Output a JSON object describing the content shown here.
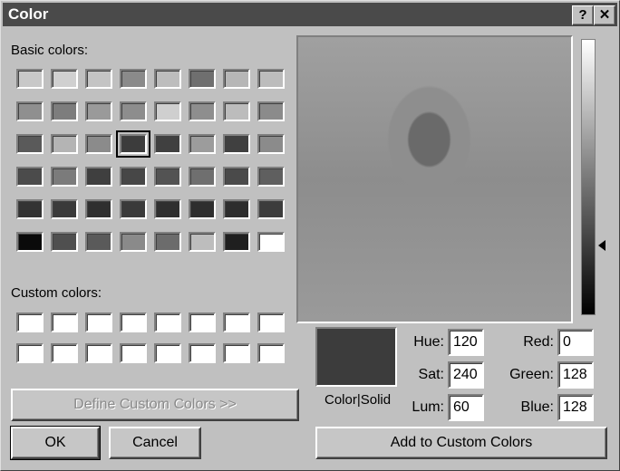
{
  "window": {
    "title": "Color",
    "help_button": "?",
    "close_button": "✕"
  },
  "basic_colors": {
    "label": "Basic colors:",
    "swatches": [
      "#c8c8c8",
      "#d0d0d0",
      "#c4c4c4",
      "#8a8a8a",
      "#bdbdbd",
      "#6f6f6f",
      "#b6b6b6",
      "#bcbcbc",
      "#8f8f8f",
      "#7d7d7d",
      "#9a9a9a",
      "#8d8d8d",
      "#cfcfcf",
      "#8e8e8e",
      "#bcbcbc",
      "#8b8b8b",
      "#5a5a5a",
      "#b4b4b4",
      "#8b8b8b",
      "#3c3c3c",
      "#404040",
      "#9c9c9c",
      "#404040",
      "#8b8b8b",
      "#4b4b4b",
      "#7b7b7b",
      "#3f3f3f",
      "#474747",
      "#535353",
      "#6f6f6f",
      "#4a4a4a",
      "#5f5f5f",
      "#333333",
      "#3a3a3a",
      "#2f2f2f",
      "#3a3a3a",
      "#2f2f2f",
      "#2e2e2e",
      "#2d2d2d",
      "#3c3c3c",
      "#0a0a0a",
      "#4f4f4f",
      "#5a5a5a",
      "#8a8a8a",
      "#6c6c6c",
      "#bdbdbd",
      "#1f1f1f",
      "#ffffff"
    ],
    "selected_index": 19
  },
  "custom_colors": {
    "label": "Custom colors:",
    "swatches": [
      "#ffffff",
      "#ffffff",
      "#ffffff",
      "#ffffff",
      "#ffffff",
      "#ffffff",
      "#ffffff",
      "#ffffff",
      "#ffffff",
      "#ffffff",
      "#ffffff",
      "#ffffff",
      "#ffffff",
      "#ffffff",
      "#ffffff",
      "#ffffff"
    ]
  },
  "buttons": {
    "define_custom": "Define Custom Colors >>",
    "ok": "OK",
    "cancel": "Cancel",
    "add_to_custom": "Add to Custom Colors"
  },
  "preview_label": "Color|Solid",
  "values": {
    "hue_label": "Hue:",
    "hue": "120",
    "sat_label": "Sat:",
    "sat": "240",
    "lum_label": "Lum:",
    "lum": "60",
    "red_label": "Red:",
    "red": "0",
    "green_label": "Green:",
    "green": "128",
    "blue_label": "Blue:",
    "blue": "128"
  },
  "colors": {
    "titlebar": "#4a4a4a",
    "preview": "#3c3c3c"
  }
}
